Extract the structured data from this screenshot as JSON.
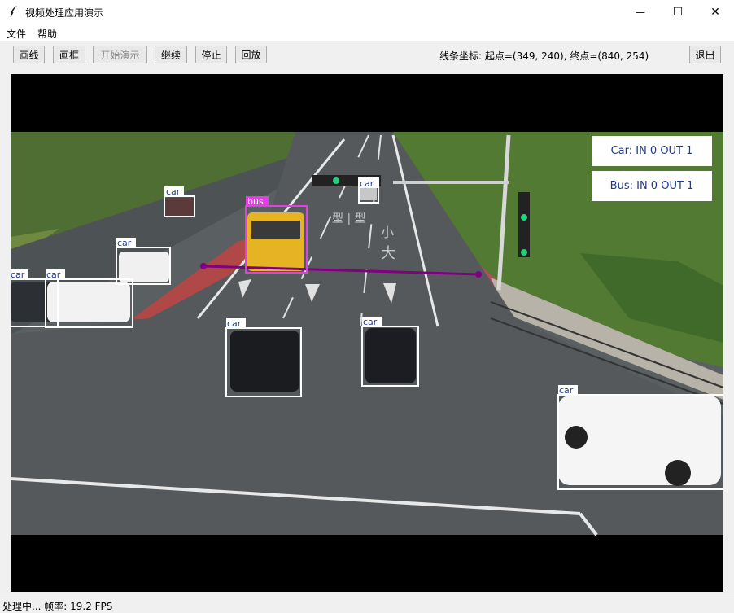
{
  "window": {
    "title": "视频处理应用演示",
    "minimize_glyph": "—",
    "maximize_glyph": "☐",
    "close_glyph": "✕"
  },
  "menu": {
    "items": [
      "文件",
      "帮助"
    ]
  },
  "toolbar": {
    "buttons": [
      "画线",
      "画框",
      "开始演示",
      "继续",
      "停止",
      "回放"
    ],
    "coords_text": "线条坐标: 起点=(349, 240), 终点=(840, 254)",
    "exit_label": "退出"
  },
  "counters": {
    "car": "Car: IN 0 OUT 1",
    "bus": "Bus: IN 0 OUT 1"
  },
  "detections": [
    {
      "label": "car",
      "color": "#ffffff"
    },
    {
      "label": "bus",
      "color": "#e040e0"
    },
    {
      "label": "car",
      "color": "#ffffff"
    },
    {
      "label": "car",
      "color": "#ffffff"
    },
    {
      "label": "car",
      "color": "#ffffff"
    },
    {
      "label": "car",
      "color": "#ffffff"
    },
    {
      "label": "car",
      "color": "#ffffff"
    },
    {
      "label": "car",
      "color": "#ffffff"
    },
    {
      "label": "car",
      "color": "#ffffff"
    }
  ],
  "scene_text": [
    "型 | 型",
    "小",
    "大"
  ],
  "colors": {
    "count_line": "#800080",
    "counter_text": "#1f3a8a",
    "bus_box": "#e040e0"
  },
  "status": {
    "text": "处理中... 帧率: 19.2 FPS"
  }
}
